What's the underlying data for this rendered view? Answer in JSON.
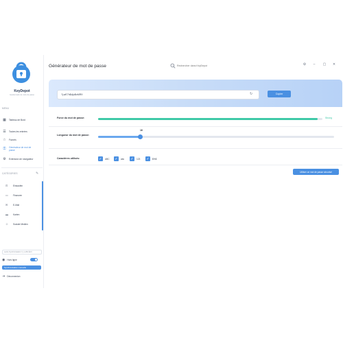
{
  "app": {
    "name": "KeyDepot",
    "subtitle": "Gestionnaire de mots de passe"
  },
  "sidebar": {
    "menu_label": "MENU",
    "items": [
      {
        "label": "Tableau de Bord",
        "icon": "dashboard-icon"
      },
      {
        "label": "Toutes les entrées",
        "icon": "list-icon"
      },
      {
        "label": "Favoris",
        "icon": "star-icon"
      },
      {
        "label": "Générateur de mot de passe",
        "icon": "key-icon",
        "active": true
      },
      {
        "label": "Extension de navigateur",
        "icon": "puzzle-icon"
      }
    ],
    "categories_label": "CATÉGORIES",
    "categories": [
      {
        "label": "Einkaufen",
        "icon": "cart-icon"
      },
      {
        "label": "Finanzen",
        "icon": "wallet-icon"
      },
      {
        "label": "E-Mail",
        "icon": "mail-icon"
      },
      {
        "label": "Karten",
        "icon": "card-icon"
      },
      {
        "label": "Soziale Medien",
        "icon": "users-icon"
      }
    ],
    "sync_status": "Letzte Synchronisation: Il y a 28s Écrit",
    "offline_label": "Hors ligne",
    "offline_enabled": true,
    "sync_button": "Synchronisation manuelle",
    "logout_label": "Déconnexion"
  },
  "header": {
    "title": "Générateur de mot de passe",
    "search_placeholder": "Rechercher dans KeyDepot",
    "controls": [
      "⚙",
      "–",
      "▢",
      "✕"
    ]
  },
  "generator": {
    "password": "?j.wE7h$djuBvMR9",
    "copy_label": "Copier",
    "strength_label": "Force du mot de passe:",
    "strength_text": "Strong",
    "strength_value": 0.98,
    "length_label": "Longueur du mot de passe:",
    "length_value": "16",
    "length_fraction": 0.18,
    "chars_label": "Caractères utilisés:",
    "options": [
      {
        "label": "ABC",
        "checked": true
      },
      {
        "label": "abc",
        "checked": true
      },
      {
        "label": "123",
        "checked": true
      },
      {
        "label": "$%$",
        "checked": true
      }
    ],
    "use_button": "Utiliser ce mot de passe sécurisé"
  },
  "colors": {
    "accent": "#4a90e2",
    "strength": "#3ec9a7"
  }
}
